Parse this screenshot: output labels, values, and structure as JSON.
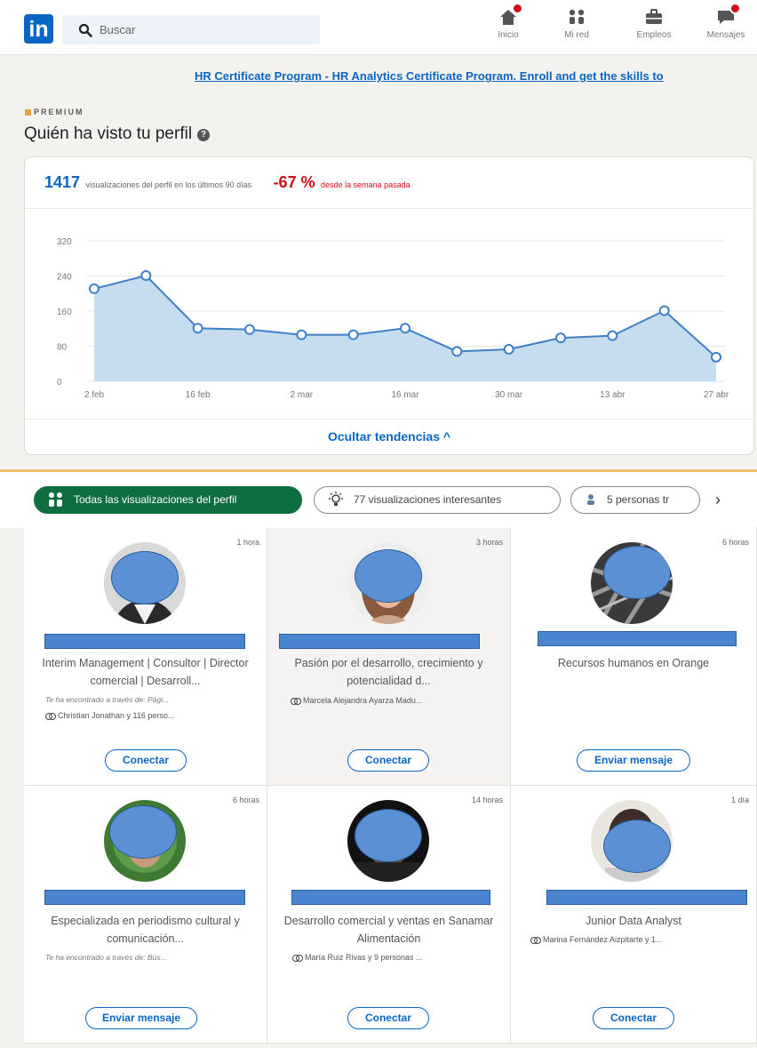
{
  "nav": {
    "logo": "in",
    "search_placeholder": "Buscar",
    "items": [
      {
        "label": "Inicio",
        "icon": "home-icon"
      },
      {
        "label": "Mi red",
        "icon": "network-icon"
      },
      {
        "label": "Empleos",
        "icon": "briefcase-icon"
      },
      {
        "label": "Mensajes",
        "icon": "messaging-icon"
      }
    ]
  },
  "ad": {
    "text": "HR Certificate Program - HR Analytics Certificate Program. Enroll and get the skills to"
  },
  "premium_label": "PREMIUM",
  "page_title": "Quién ha visto tu perfil",
  "stats": {
    "views": "1417",
    "views_text": "visualizaciones del perfil en los últimos 90 días",
    "delta": "-67 %",
    "delta_text": "desde la semana pasada",
    "hide_trends": "Ocultar tendencias ^"
  },
  "chart_data": {
    "type": "area",
    "title": "",
    "xlabel": "",
    "ylabel": "",
    "ylim": [
      0,
      320
    ],
    "yticks": [
      "0",
      "80",
      "160",
      "240",
      "320"
    ],
    "xticks": [
      "2 feb",
      "16 feb",
      "2 mar",
      "16 mar",
      "30 mar",
      "13 abr",
      "27 abr"
    ],
    "x": [
      "2 feb",
      "9 feb",
      "16 feb",
      "23 feb",
      "2 mar",
      "9 mar",
      "16 mar",
      "23 mar",
      "30 mar",
      "6 abr",
      "13 abr",
      "20 abr",
      "27 abr"
    ],
    "values": [
      211,
      241,
      121,
      118,
      106,
      106,
      121,
      68,
      73,
      99,
      104,
      161,
      55
    ],
    "color": "#3f80c8",
    "fill": "#c6dcef",
    "grid": true
  },
  "filters": {
    "all": "Todas las visualizaciones del perfil",
    "interesting": "77 visualizaciones interesantes",
    "people": "5 personas tr",
    "next": "›"
  },
  "viewers": [
    {
      "time": "1 hora",
      "headline": "Interim Management | Consultor | Director comercial | Desarroll...",
      "via": "Te ha encontrado a través de: Pági...",
      "shared": "Christian Jonathan y 116 perso...",
      "button": "Conectar"
    },
    {
      "time": "3 horas",
      "headline": "Pasión por el desarrollo, crecimiento y potencialidad d...",
      "via": "",
      "shared": "Marcela Alejandra Ayarza Madu...",
      "button": "Conectar"
    },
    {
      "time": "6 horas",
      "headline": "Recursos humanos en Orange",
      "via": "",
      "shared": "",
      "button": "Enviar mensaje"
    },
    {
      "time": "6 horas",
      "headline": "Especializada en periodismo cultural y comunicación...",
      "via": "Te ha encontrado a través de: Bús...",
      "shared": "",
      "button": "Enviar mensaje"
    },
    {
      "time": "14 horas",
      "headline": "Desarrollo comercial y ventas en Sanamar Alimentación",
      "via": "",
      "shared": "María Ruiz Rivas y 9 personas ...",
      "button": "Conectar"
    },
    {
      "time": "1 día",
      "headline": "Junior Data Analyst",
      "via": "",
      "shared": "Marina Fernández Aizpitarte y 1...",
      "button": "Conectar"
    }
  ]
}
